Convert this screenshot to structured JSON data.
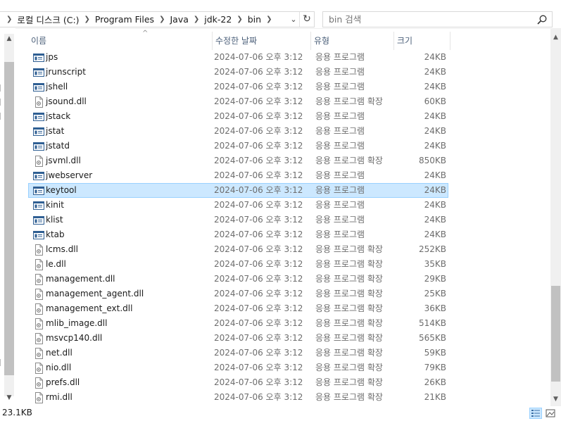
{
  "address": {
    "crumbs": [
      "로컬 디스크 (C:)",
      "Program Files",
      "Java",
      "jdk-22",
      "bin"
    ]
  },
  "search": {
    "placeholder": "bin 검색"
  },
  "columns": {
    "name": "이름",
    "date": "수정한 날짜",
    "type": "유형",
    "size": "크기"
  },
  "files": [
    {
      "name": "jps",
      "date": "2024-07-06 오후 3:12",
      "type": "응용 프로그램",
      "size": "24KB",
      "icon": "app"
    },
    {
      "name": "jrunscript",
      "date": "2024-07-06 오후 3:12",
      "type": "응용 프로그램",
      "size": "24KB",
      "icon": "app"
    },
    {
      "name": "jshell",
      "date": "2024-07-06 오후 3:12",
      "type": "응용 프로그램",
      "size": "24KB",
      "icon": "app"
    },
    {
      "name": "jsound.dll",
      "date": "2024-07-06 오후 3:12",
      "type": "응용 프로그램 확장",
      "size": "60KB",
      "icon": "dll"
    },
    {
      "name": "jstack",
      "date": "2024-07-06 오후 3:12",
      "type": "응용 프로그램",
      "size": "24KB",
      "icon": "app"
    },
    {
      "name": "jstat",
      "date": "2024-07-06 오후 3:12",
      "type": "응용 프로그램",
      "size": "24KB",
      "icon": "app"
    },
    {
      "name": "jstatd",
      "date": "2024-07-06 오후 3:12",
      "type": "응용 프로그램",
      "size": "24KB",
      "icon": "app"
    },
    {
      "name": "jsvml.dll",
      "date": "2024-07-06 오후 3:12",
      "type": "응용 프로그램 확장",
      "size": "850KB",
      "icon": "dll"
    },
    {
      "name": "jwebserver",
      "date": "2024-07-06 오후 3:12",
      "type": "응용 프로그램",
      "size": "24KB",
      "icon": "app"
    },
    {
      "name": "keytool",
      "date": "2024-07-06 오후 3:12",
      "type": "응용 프로그램",
      "size": "24KB",
      "icon": "app",
      "selected": true
    },
    {
      "name": "kinit",
      "date": "2024-07-06 오후 3:12",
      "type": "응용 프로그램",
      "size": "24KB",
      "icon": "app"
    },
    {
      "name": "klist",
      "date": "2024-07-06 오후 3:12",
      "type": "응용 프로그램",
      "size": "24KB",
      "icon": "app"
    },
    {
      "name": "ktab",
      "date": "2024-07-06 오후 3:12",
      "type": "응용 프로그램",
      "size": "24KB",
      "icon": "app"
    },
    {
      "name": "lcms.dll",
      "date": "2024-07-06 오후 3:12",
      "type": "응용 프로그램 확장",
      "size": "252KB",
      "icon": "dll"
    },
    {
      "name": "le.dll",
      "date": "2024-07-06 오후 3:12",
      "type": "응용 프로그램 확장",
      "size": "35KB",
      "icon": "dll"
    },
    {
      "name": "management.dll",
      "date": "2024-07-06 오후 3:12",
      "type": "응용 프로그램 확장",
      "size": "29KB",
      "icon": "dll"
    },
    {
      "name": "management_agent.dll",
      "date": "2024-07-06 오후 3:12",
      "type": "응용 프로그램 확장",
      "size": "25KB",
      "icon": "dll"
    },
    {
      "name": "management_ext.dll",
      "date": "2024-07-06 오후 3:12",
      "type": "응용 프로그램 확장",
      "size": "36KB",
      "icon": "dll"
    },
    {
      "name": "mlib_image.dll",
      "date": "2024-07-06 오후 3:12",
      "type": "응용 프로그램 확장",
      "size": "514KB",
      "icon": "dll"
    },
    {
      "name": "msvcp140.dll",
      "date": "2024-07-06 오후 3:12",
      "type": "응용 프로그램 확장",
      "size": "565KB",
      "icon": "dll"
    },
    {
      "name": "net.dll",
      "date": "2024-07-06 오후 3:12",
      "type": "응용 프로그램 확장",
      "size": "59KB",
      "icon": "dll"
    },
    {
      "name": "nio.dll",
      "date": "2024-07-06 오후 3:12",
      "type": "응용 프로그램 확장",
      "size": "79KB",
      "icon": "dll"
    },
    {
      "name": "prefs.dll",
      "date": "2024-07-06 오후 3:12",
      "type": "응용 프로그램 확장",
      "size": "26KB",
      "icon": "dll"
    },
    {
      "name": "rmi.dll",
      "date": "2024-07-06 오후 3:12",
      "type": "응용 프로그램 확장",
      "size": "21KB",
      "icon": "dll"
    }
  ],
  "status": {
    "selection_size": "23.1KB"
  },
  "colors": {
    "selection_bg": "#cce8ff",
    "selection_border": "#99d1ff",
    "header_text": "#4c607a",
    "meta_text": "#6d6d6d"
  }
}
